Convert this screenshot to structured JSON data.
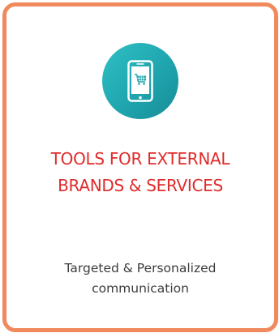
{
  "colors": {
    "border": "#f08a5d",
    "title": "#e02b2b",
    "icon_circle": "#1fa5ae"
  },
  "card": {
    "icon": "smartphone-shopping-cart-icon",
    "title_lines": [
      "TOOLS FOR EXTERNAL",
      "BRANDS & SERVICES"
    ],
    "description_lines": [
      "Targeted & Personalized",
      "communication"
    ]
  }
}
